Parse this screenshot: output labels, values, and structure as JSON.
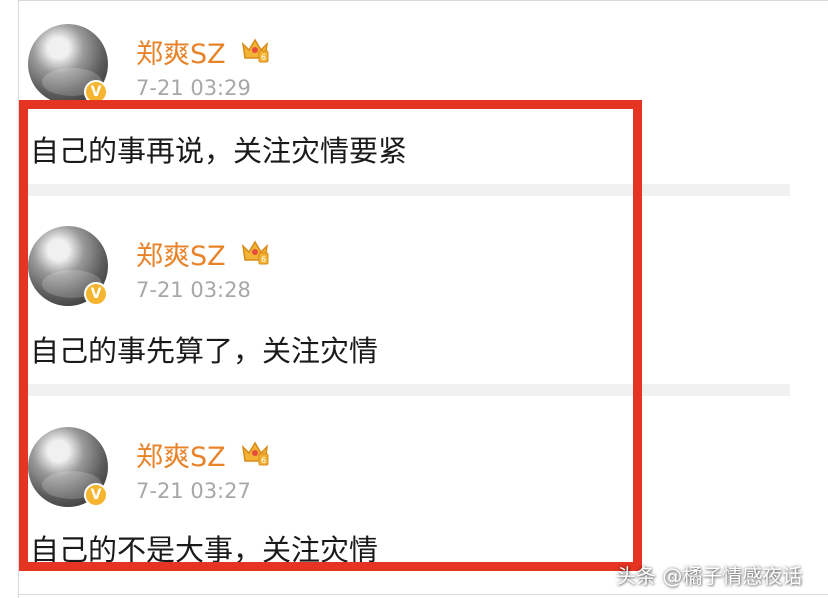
{
  "posts": [
    {
      "username": "郑爽SZ",
      "verified_badge": "V",
      "timestamp": "7-21 03:29",
      "text": "自己的事再说，关注灾情要紧"
    },
    {
      "username": "郑爽SZ",
      "verified_badge": "V",
      "timestamp": "7-21 03:28",
      "text": "自己的事先算了，关注灾情"
    },
    {
      "username": "郑爽SZ",
      "verified_badge": "V",
      "timestamp": "7-21 03:27",
      "text": "自己的不是大事，关注灾情"
    }
  ],
  "icons": {
    "member": "crown-icon",
    "verified": "verified-v-icon"
  },
  "colors": {
    "username": "#e8832a",
    "highlight_border": "#e53422",
    "verified_badge": "#f5b52e",
    "timestamp": "#a7a7a7"
  },
  "watermark": {
    "text": "头条 @橘子情感夜话"
  }
}
